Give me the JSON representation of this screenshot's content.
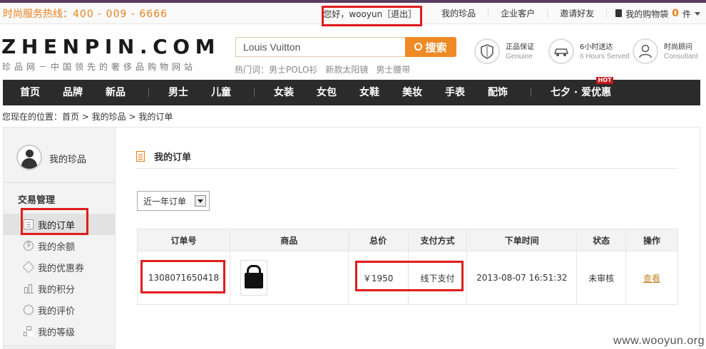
{
  "topbar": {
    "hotline_label": "时尚服务热线：",
    "hotline_number": "400 - 009 - 6666",
    "greeting": "您好，wooyun［退出］",
    "links": [
      "我的珍品",
      "企业客户",
      "邀请好友"
    ],
    "cart_label": "我的购物袋",
    "cart_count": "0",
    "cart_unit": "件"
  },
  "header": {
    "logo": "ZHENPIN.COM",
    "slogan": "珍品网－中国领先的奢侈品购物网站",
    "search": {
      "value": "Louis Vuitton",
      "button_label": "搜索"
    },
    "hot_words_label": "热门词：",
    "hot_words": [
      "男士POLO衫",
      "新款太阳镜",
      "男士腰带"
    ],
    "services": [
      {
        "title": "正品保证",
        "subtitle": "Genuine",
        "icon": "shield-icon"
      },
      {
        "title": "6小时送达",
        "subtitle": "6 Hours Served",
        "icon": "car-icon"
      },
      {
        "title": "时尚顾问",
        "subtitle": "Consultant",
        "icon": "person-icon"
      }
    ]
  },
  "nav": {
    "items": [
      "首页",
      "品牌",
      "新品",
      "男士",
      "儿童",
      "女装",
      "女包",
      "女鞋",
      "美妆",
      "手表",
      "配饰",
      "七夕 · 爱优惠"
    ],
    "hot_badge": "HOT"
  },
  "breadcrumb": "您现在的位置：首页 > 我的珍品 > 我的订单",
  "sidebar": {
    "profile_label": "我的珍品",
    "section_title": "交易管理",
    "items": [
      {
        "label": "我的订单",
        "icon": "document-icon"
      },
      {
        "label": "我的余额",
        "icon": "coin-icon"
      },
      {
        "label": "我的优惠券",
        "icon": "tag-icon"
      },
      {
        "label": "我的积分",
        "icon": "bar-chart-icon"
      },
      {
        "label": "我的评价",
        "icon": "speech-bubble-icon"
      },
      {
        "label": "我的等级",
        "icon": "hierarchy-icon"
      }
    ]
  },
  "main": {
    "title": "我的订单",
    "filter_selected": "近一年订单",
    "table": {
      "headers": [
        "订单号",
        "商品",
        "总价",
        "支付方式",
        "下单时间",
        "状态",
        "操作"
      ],
      "rows": [
        {
          "order_no": "1308071650418",
          "product_image": "black-handbag",
          "total": "￥1950",
          "payment": "线下支付",
          "time": "2013-08-07 16:51:32",
          "status": "未审核",
          "action": "查看"
        }
      ]
    }
  },
  "watermark": "www.wooyun.org",
  "colors": {
    "accent": "#f08a24",
    "nav_bg": "#2b2b2b",
    "highlight": "#e11c1c",
    "link": "#c8862a"
  }
}
